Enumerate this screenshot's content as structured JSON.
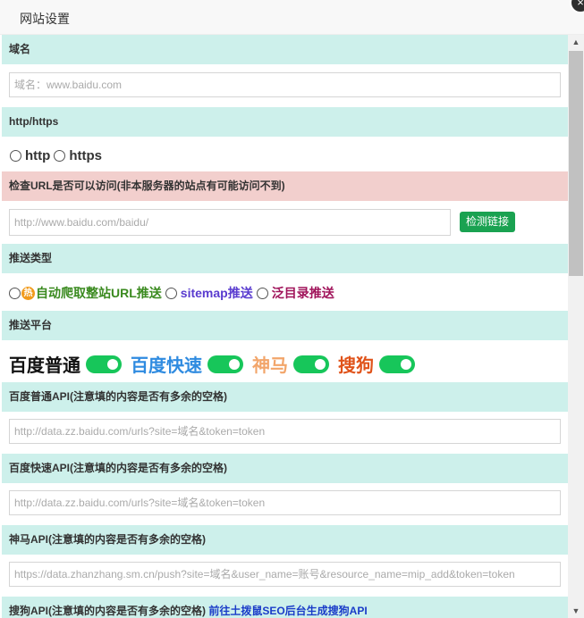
{
  "window": {
    "title": "网站设置",
    "close_symbol": "×"
  },
  "sections": {
    "domain": {
      "label": "域名",
      "placeholder": "域名：www.baidu.com"
    },
    "protocol": {
      "label": "http/https",
      "options": [
        "http",
        "https"
      ]
    },
    "check_url": {
      "label": "检查URL是否可以访问(非本服务器的站点有可能访问不到)",
      "placeholder": "http://www.baidu.com/baidu/",
      "button": "检测链接"
    },
    "push_type": {
      "label": "推送类型",
      "hot_icon_text": "热",
      "options": [
        "自动爬取整站URL推送",
        "sitemap推送",
        "泛目录推送"
      ],
      "colors": [
        "#3a8a1f",
        "#5a3ccf",
        "#a0135a"
      ]
    },
    "platforms": {
      "label": "推送平台",
      "items": [
        "百度普通",
        "百度快速",
        "神马",
        "搜狗"
      ],
      "colors": [
        "#111111",
        "#2f8be0",
        "#f2a56a",
        "#e0531a"
      ],
      "toggle_color": "#17c65a"
    },
    "baidu_normal_api": {
      "label": "百度普通API(注意填的内容是否有多余的空格)",
      "placeholder": "http://data.zz.baidu.com/urls?site=域名&token=token"
    },
    "baidu_fast_api": {
      "label": "百度快速API(注意填的内容是否有多余的空格)",
      "placeholder": "http://data.zz.baidu.com/urls?site=域名&token=token"
    },
    "shenma_api": {
      "label": "神马API(注意填的内容是否有多余的空格)",
      "placeholder": "https://data.zhanzhang.sm.cn/push?site=域名&user_name=账号&resource_name=mip_add&token=token"
    },
    "sogou_api": {
      "label": "搜狗API(注意填的内容是否有多余的空格)",
      "link": "前往土拨鼠SEO后台生成搜狗API"
    }
  },
  "scrollbar": {
    "up": "▲",
    "down": "▼"
  }
}
